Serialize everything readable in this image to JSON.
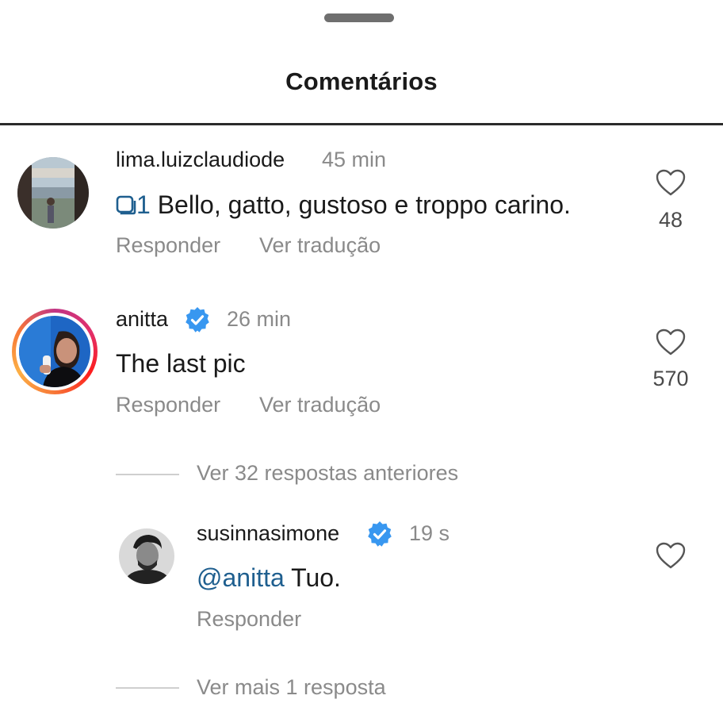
{
  "header": {
    "title": "Comentários"
  },
  "comments": [
    {
      "username": "lima.luizclaudiode",
      "time": "45 min",
      "thread_count": "1",
      "text": "Bello, gatto, gustoso e troppo carino.",
      "likes": "48",
      "reply_label": "Responder",
      "translate_label": "Ver tradução"
    },
    {
      "username": "anitta",
      "time": "26 min",
      "text": "The last pic",
      "likes": "570",
      "reply_label": "Responder",
      "translate_label": "Ver tradução",
      "previous_replies": "Ver 32 respostas anteriores",
      "reply": {
        "username": "susinnasimone",
        "time": "19 s",
        "mention": "@anitta",
        "text": " Tuo.",
        "reply_label": "Responder"
      },
      "more_replies": "Ver mais 1 resposta"
    }
  ],
  "icons": {
    "heart": "heart-icon",
    "verified": "verified-badge-icon",
    "thread": "thread-icon"
  },
  "colors": {
    "verified": "#3897f0",
    "mention": "#1f5f8f",
    "muted": "#8a8a8a"
  }
}
